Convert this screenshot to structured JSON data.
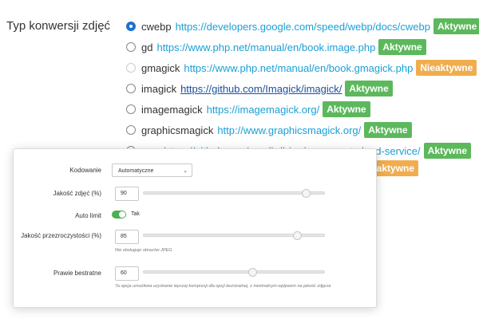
{
  "section": {
    "title": "Typ konwersji zdjęć"
  },
  "options": [
    {
      "name": "cwebp",
      "url": "https://developers.google.com/speed/webp/docs/cwebp",
      "status": "Aktywne",
      "state": "checked"
    },
    {
      "name": "gd",
      "url": "https://www.php.net/manual/en/book.image.php",
      "status": "Aktywne",
      "state": "normal"
    },
    {
      "name": "gmagick",
      "url": "https://www.php.net/manual/en/book.gmagick.php",
      "status": "Nieaktywne",
      "state": "disabled"
    },
    {
      "name": "imagick",
      "url": "https://github.com/Imagick/imagick/",
      "status": "Aktywne",
      "state": "normal"
    },
    {
      "name": "imagemagick",
      "url": "https://imagemagick.org/",
      "status": "Aktywne",
      "state": "normal"
    },
    {
      "name": "graphicsmagick",
      "url": "http://www.graphicsmagick.org/",
      "status": "Aktywne",
      "state": "normal"
    },
    {
      "name": "wpc",
      "url": "https://github.com/rosell-dk/webp-convert-cloud-service/",
      "status": "Aktywne",
      "state": "normal"
    },
    {
      "name": "",
      "url": "",
      "status": "Nieaktywne",
      "state": "normal"
    }
  ],
  "popup": {
    "encoding": {
      "label": "Kodowanie",
      "value": "Automatyczne"
    },
    "quality": {
      "label": "Jakość zdjęć (%)",
      "value": "90",
      "fraction": 0.9
    },
    "auto_limit": {
      "label": "Auto limit",
      "value": "Tak"
    },
    "alpha": {
      "label": "Jakość przezroczystości (%)",
      "value": "85",
      "fraction": 0.85,
      "note": "Nie obsługuje obrazów JPEG"
    },
    "near_lossless": {
      "label": "Prawie bestratne",
      "value": "60",
      "fraction": 0.6,
      "note": "Ta opcja umożliwia uzyskanie lepszej kompresji dla opcji bezstratnej, z minimalnym wpływem na jakość zdjęcia"
    }
  },
  "colors": {
    "active_badge": "#5cb85c",
    "inactive_badge": "#f0ad4e",
    "link": "#1a9fd6",
    "radio_checked": "#1f6fd0",
    "toggle": "#4caf50"
  }
}
